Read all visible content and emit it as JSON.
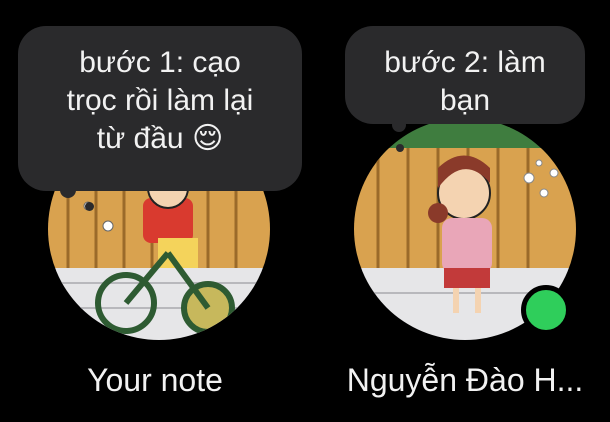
{
  "notes": [
    {
      "text_line1": "bước 1: cạo",
      "text_line2": "trọc rồi làm lại",
      "text_line3": "từ đầu",
      "emoji": "😌",
      "name": "Your note",
      "avatar_icon": "cartoon-boy-on-tricycle"
    },
    {
      "text_line1": "bước 2: làm",
      "text_line2": "bạn",
      "name": "Nguyễn Đào H...",
      "avatar_icon": "cartoon-girl-blowing-bubbles",
      "status": "online",
      "status_color": "#2fce5b"
    }
  ],
  "colors": {
    "background": "#000000",
    "bubble": "#2a2a2c",
    "text": "#f2f2f2"
  }
}
